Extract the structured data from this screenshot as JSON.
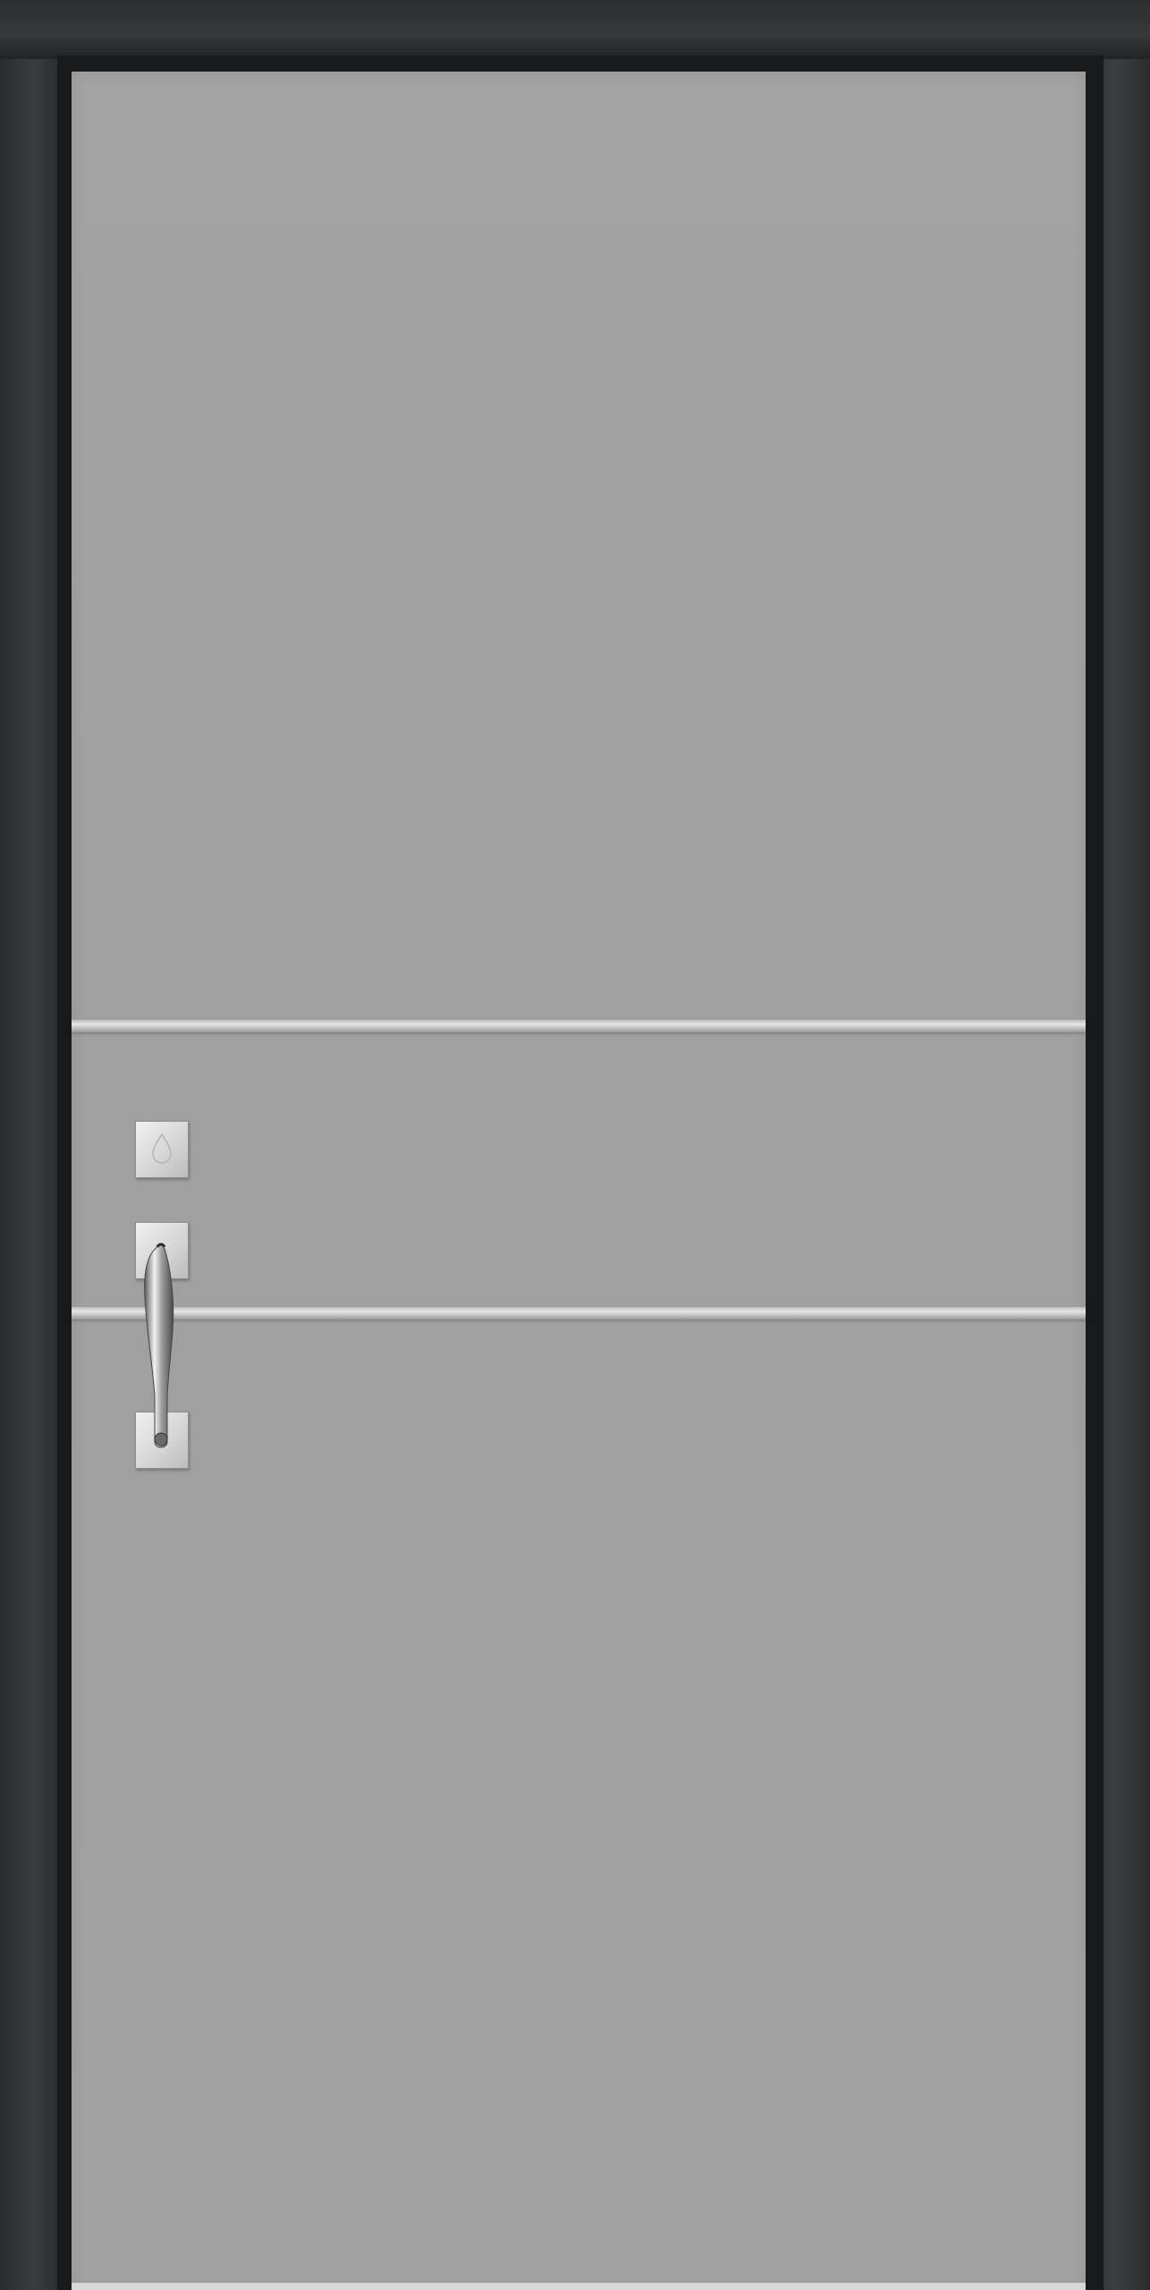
{
  "scene": {
    "subject": "door",
    "colors": {
      "frame": "#2b2d2f",
      "leaf": "#a1a1a1",
      "trim": "#dcdcdc",
      "hardware": "#c8c8c8"
    },
    "features": {
      "horizontal_inlays": 2,
      "hardware": [
        "sensor-plate",
        "handle",
        "handle-mount-plates"
      ]
    }
  }
}
